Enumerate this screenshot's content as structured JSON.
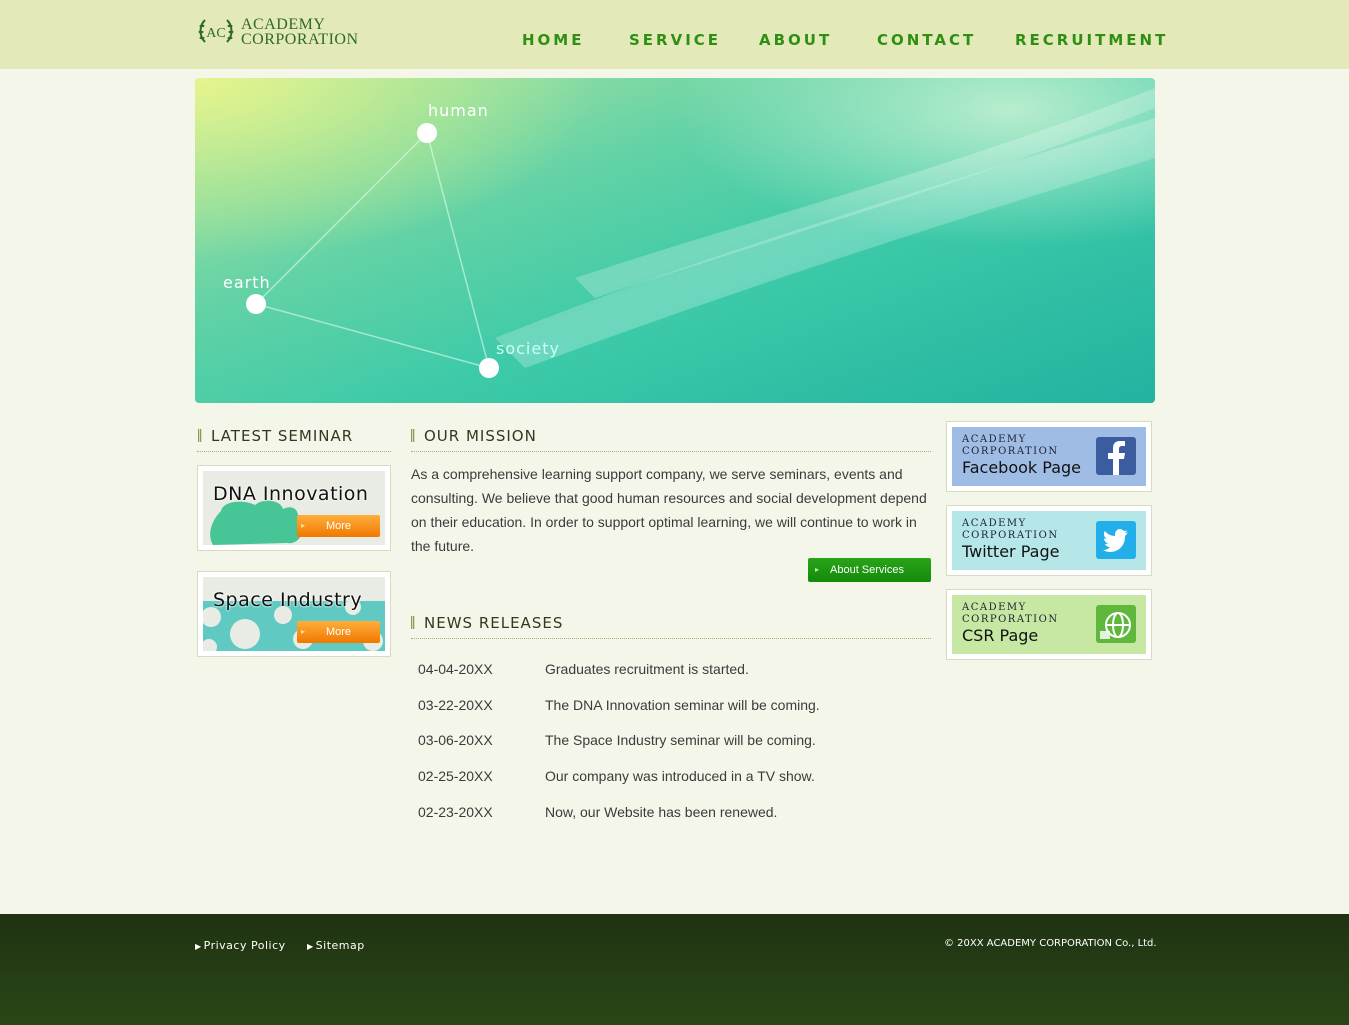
{
  "header": {
    "logo_line1": "ACADEMY",
    "logo_line2": "CORPORATION",
    "logo_mark": "AC",
    "nav": [
      "HOME",
      "SERVICE",
      "ABOUT",
      "CONTACT",
      "RECRUITMENT"
    ]
  },
  "hero": {
    "labels": [
      "human",
      "earth",
      "society"
    ]
  },
  "sidebar": {
    "title": "LATEST SEMINAR",
    "seminars": [
      {
        "title": "DNA Innovation",
        "button": "More"
      },
      {
        "title": "Space Industry",
        "button": "More"
      }
    ]
  },
  "mission": {
    "title": "OUR MISSION",
    "text": "As a comprehensive learning support company, we serve seminars, events and consulting. We believe that good human resources and social development depend on their education. In order to support optimal learning, we will continue to work in the future.",
    "button": "About Services"
  },
  "news": {
    "title": "NEWS RELEASES",
    "items": [
      {
        "date": "04-04-20XX",
        "text": "Graduates recruitment is started."
      },
      {
        "date": "03-22-20XX",
        "text": "The DNA Innovation seminar will be coming."
      },
      {
        "date": "03-06-20XX",
        "text": "The Space Industry seminar will be coming."
      },
      {
        "date": "02-25-20XX",
        "text": "Our company was introduced in a TV show."
      },
      {
        "date": "02-23-20XX",
        "text": "Now, our Website has been renewed."
      }
    ]
  },
  "social": [
    {
      "line1": "ACADEMY",
      "line2": "CORPORATION",
      "big": "Facebook Page",
      "icon": "facebook-icon",
      "bg": "#9fbde4",
      "icon_color": "#3b5c9e"
    },
    {
      "line1": "ACADEMY",
      "line2": "CORPORATION",
      "big": "Twitter Page",
      "icon": "twitter-icon",
      "bg": "#b5e6e8",
      "icon_color": "#22aee8"
    },
    {
      "line1": "ACADEMY",
      "line2": "CORPORATION",
      "big": "CSR Page",
      "icon": "globe-icon",
      "bg": "#c7e8a2",
      "icon_color": "#5fb83c"
    }
  ],
  "footer": {
    "links": [
      "Privacy Policy",
      "Sitemap"
    ],
    "copyright": "© 20XX ACADEMY CORPORATION Co., Ltd."
  }
}
